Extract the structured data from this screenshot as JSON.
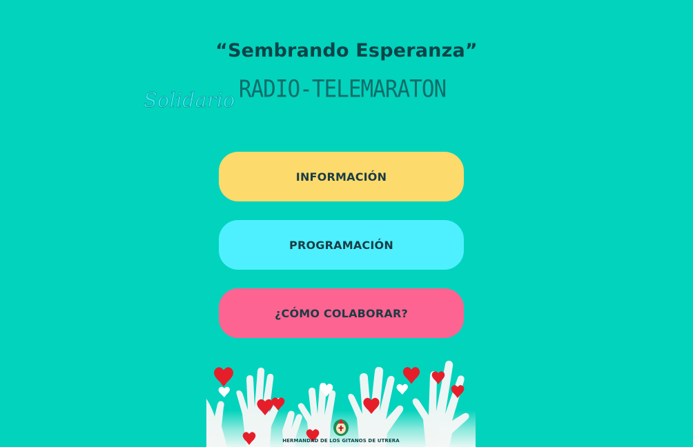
{
  "page": {
    "background_color": "#02d3bd"
  },
  "header": {
    "slogan": "“Sembrando Esperanza”",
    "slogan_color": "#0b4548",
    "logo_line1": "RADIO-TELEMARATON",
    "logo_line1_color": "#0e6e6a",
    "logo_line2": "Solidario",
    "logo_line2_color": "#36e6f2"
  },
  "menu": {
    "text_color": "#1a3c44",
    "buttons": [
      {
        "label": "INFORMACIÓN",
        "color": "#fcda6c"
      },
      {
        "label": "PROGRAMACIÓN",
        "color": "#4ef0ff"
      },
      {
        "label": "¿CÓMO COLABORAR?",
        "color": "#fe6491"
      }
    ]
  },
  "banner": {
    "icon": "raised-hands-hearts-illustration",
    "emblem_icon": "brotherhood-crest-icon",
    "caption": "HERMANDAD DE LOS GITANOS DE UTRERA",
    "caption_color": "#0b4548",
    "heart_color": "#e61e2a"
  }
}
